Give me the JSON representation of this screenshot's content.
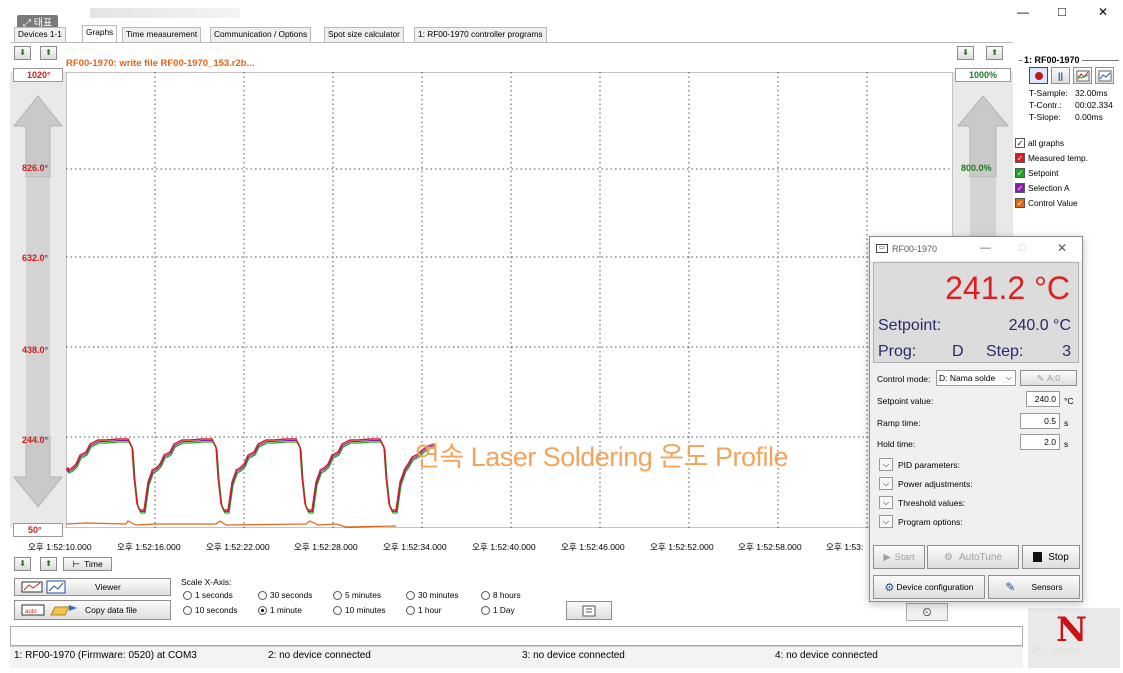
{
  "title_overlay": "⤢ 태표",
  "window_controls": {
    "minimize": "—",
    "maximize": "□",
    "close": "✕"
  },
  "tabs": [
    {
      "label": "Devices 1-1",
      "active": false
    },
    {
      "label": "Graphs",
      "active": true
    },
    {
      "label": "Time measurement",
      "active": false
    },
    {
      "label": "Communication / Options",
      "active": false
    },
    {
      "label": "Spot size calculator",
      "active": false
    },
    {
      "label": "1: RF00-1970 controller programs",
      "active": false
    }
  ],
  "graph": {
    "file_label": "RF00-1970: write file RF00-1970_153.r2b...",
    "left_top": "1020°",
    "left_bottom": "50°",
    "left_ticks": [
      "826.0°",
      "632.0°",
      "438.0°",
      "244.0°"
    ],
    "right_top": "1000%",
    "right_ticks": [
      "800.0%"
    ],
    "x_ticks": [
      "오후 1:52:10.000",
      "오후 1:52:16.000",
      "오후 1:52:22.000",
      "오후 1:52:28.000",
      "오후 1:52:34.000",
      "오후 1:52:40.000",
      "오후 1:52:46.000",
      "오후 1:52:52.000",
      "오후 1:52:58.000",
      "오후 1:53:"
    ],
    "overlay_text": "연속 Laser Soldering 온도 Profile",
    "time_button": "Time",
    "colors": {
      "measured": "#d42020",
      "setpoint": "#1aa81a",
      "selection": "#8a1ab0",
      "control": "#e0661a",
      "label_red": "#c8201e"
    }
  },
  "right_panel": {
    "device": "1: RF00-1970",
    "t_sample_label": "T-Sample:",
    "t_sample": "32.00ms",
    "t_contr_label": "T-Contr.:",
    "t_contr": "00:02.334",
    "t_slope_label": "T-Slope:",
    "t_slope": "0.00ms",
    "checks": [
      {
        "label": "all graphs",
        "color": "#ffffff",
        "mark": "✓"
      },
      {
        "label": "Measured temp.",
        "color": "#d42020",
        "mark": "✓"
      },
      {
        "label": "Setpoint",
        "color": "#1aa81a",
        "mark": "✓"
      },
      {
        "label": "Selection A",
        "color": "#8a1ab0",
        "mark": "✓"
      },
      {
        "label": "Control Value",
        "color": "#e0661a",
        "mark": "✓"
      }
    ]
  },
  "bottom": {
    "viewer": "Viewer",
    "copy_data": "Copy data file",
    "scale_label": "Scale X-Axis:",
    "radios": [
      {
        "label": "1 seconds",
        "on": false
      },
      {
        "label": "30 seconds",
        "on": false
      },
      {
        "label": "5 minutes",
        "on": false
      },
      {
        "label": "30 minutes",
        "on": false
      },
      {
        "label": "8 hours",
        "on": false
      },
      {
        "label": "10 seconds",
        "on": false
      },
      {
        "label": "1 minute",
        "on": true
      },
      {
        "label": "10 minutes",
        "on": false
      },
      {
        "label": "1 hour",
        "on": false
      },
      {
        "label": "1 Day",
        "on": false
      }
    ]
  },
  "popup": {
    "title": "RF00-1970",
    "temp": "241.2 °C",
    "setpoint_label": "Setpoint:",
    "setpoint_value": "240.0 °C",
    "prog_label": "Prog:",
    "prog_value": "D",
    "step_label": "Step:",
    "step_value": "3",
    "control_mode_label": "Control mode:",
    "control_mode_value": "D: Nama solde",
    "a0_button": "A:0",
    "setpoint_field_label": "Setpoint value:",
    "setpoint_field": "240.0",
    "setpoint_unit": "°C",
    "ramp_label": "Ramp time:",
    "ramp_value": "0.5",
    "ramp_unit": "s",
    "hold_label": "Hold time:",
    "hold_value": "2.0",
    "hold_unit": "s",
    "expanders": [
      "PID parameters:",
      "Power adjustments:",
      "Threshold values:",
      "Program options:"
    ],
    "start": "Start",
    "autotune": "AutoTune",
    "stop": "Stop",
    "device_config": "Device configuration",
    "sensors": "Sensors"
  },
  "statusbar": [
    "1: RF00-1970 (Firmware: 0520) at COM3",
    "2: no device connected",
    "3: no device connected",
    "4: no device connected"
  ],
  "logo": {
    "letter": "N",
    "text": "EN... Industry"
  }
}
